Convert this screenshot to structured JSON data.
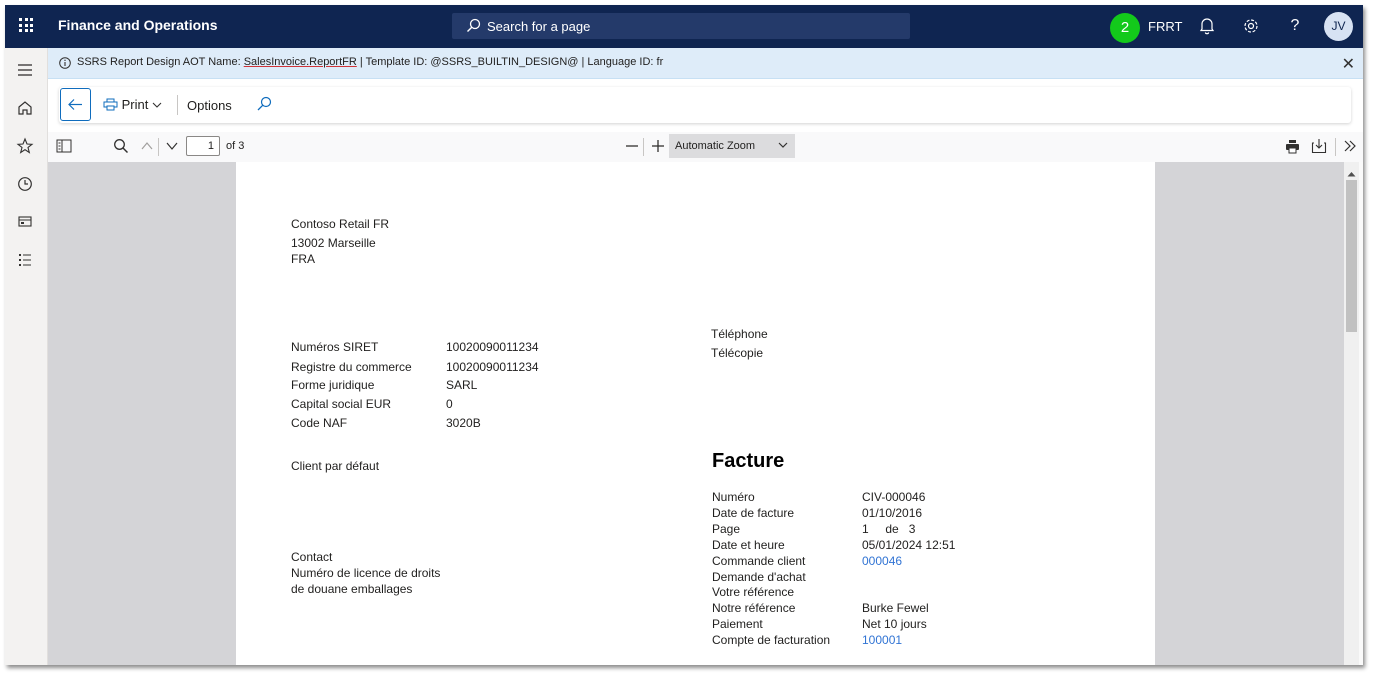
{
  "header": {
    "app_title": "Finance and Operations",
    "search_placeholder": "Search for a page",
    "notification_count": "2",
    "company": "FRRT",
    "user_initials": "JV"
  },
  "banner": {
    "prefix": "SSRS Report Design AOT Name: ",
    "report_name": "SalesInvoice.ReportFR",
    "suffix": " | Template ID: @SSRS_BUILTIN_DESIGN@ | Language ID: fr"
  },
  "action_pane": {
    "print_label": "Print",
    "options_label": "Options"
  },
  "pdf_toolbar": {
    "page_number": "1",
    "of_pages": "of 3",
    "zoom_value": "Automatic Zoom"
  },
  "document": {
    "company_lines": [
      "Contoso Retail FR",
      "13002 Marseille",
      "FRA"
    ],
    "legal": [
      {
        "label": "Numéros SIRET",
        "value": "10020090011234"
      },
      {
        "label": "Registre du commerce",
        "value": "10020090011234"
      },
      {
        "label": "Forme juridique",
        "value": "SARL"
      },
      {
        "label": "Capital social EUR",
        "value": "0"
      },
      {
        "label": "Code NAF",
        "value": "3020B"
      }
    ],
    "phone_label": "Téléphone",
    "fax_label": "Télécopie",
    "customer_label": "Client par défaut",
    "contact_label": "Contact",
    "license_label_1": "Numéro de licence de droits",
    "license_label_2": "de douane emballages",
    "invoice_title": "Facture",
    "details": [
      {
        "label": "Numéro",
        "value": "CIV-000046"
      },
      {
        "label": "Date de facture",
        "value": "01/10/2016"
      },
      {
        "label": "Page",
        "value": "1     de   3"
      },
      {
        "label": "Date et heure",
        "value": "05/01/2024 12:51"
      },
      {
        "label": "Commande client",
        "value": "000046"
      },
      {
        "label": "Demande d'achat",
        "value": ""
      },
      {
        "label": "Votre référence",
        "value": ""
      },
      {
        "label": "Notre référence",
        "value": "Burke Fewel"
      },
      {
        "label": "Paiement",
        "value": "Net 10 jours"
      },
      {
        "label": "Compte de facturation",
        "value": "100001"
      }
    ]
  }
}
